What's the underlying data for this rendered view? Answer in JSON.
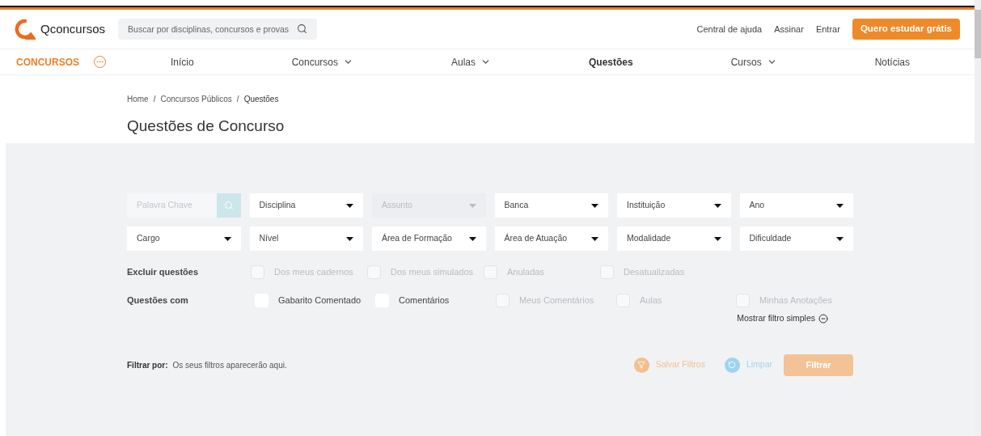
{
  "header": {
    "logo": "Qconcursos",
    "search": {
      "placeholder": "Buscar por disciplinas, concursos e provas"
    },
    "links": [
      "Central de ajuda",
      "Assinar",
      "Entrar"
    ],
    "cta": "Quero estudar grátis"
  },
  "nav": {
    "brand": "CONCURSOS",
    "items": [
      {
        "label": "Início",
        "selected": false,
        "has_menu": false
      },
      {
        "label": "Concursos",
        "selected": false,
        "has_menu": true
      },
      {
        "label": "Aulas",
        "selected": false,
        "has_menu": true
      },
      {
        "label": "Questões",
        "selected": true,
        "has_menu": false
      },
      {
        "label": "Cursos",
        "selected": false,
        "has_menu": true
      },
      {
        "label": "Notícias",
        "selected": false,
        "has_menu": false
      }
    ]
  },
  "breadcrumb": {
    "separator": "/",
    "items": [
      "Home",
      "Concursos Públicos",
      "Questões"
    ]
  },
  "title": "Questões de Concurso",
  "keyword": {
    "placeholder": "Palavra Chave"
  },
  "dropdowns": [
    {
      "label": "Disciplina",
      "disabled": false
    },
    {
      "label": "Assunto",
      "disabled": true
    },
    {
      "label": "Banca",
      "disabled": false
    },
    {
      "label": "Instituição",
      "disabled": false
    },
    {
      "label": "Ano",
      "disabled": false
    },
    {
      "label": "Cargo",
      "disabled": false
    },
    {
      "label": "Nível",
      "disabled": false
    },
    {
      "label": "Área de Formação",
      "disabled": false
    },
    {
      "label": "Área de Atuação",
      "disabled": false
    },
    {
      "label": "Modalidade",
      "disabled": false
    },
    {
      "label": "Dificuldade",
      "disabled": false
    }
  ],
  "exclude": {
    "label": "Excluir questões",
    "options": [
      {
        "label": "Dos meus cadernos",
        "checked": false,
        "disabled": true
      },
      {
        "label": "Dos meus simulados",
        "checked": false,
        "disabled": true
      },
      {
        "label": "Anuladas",
        "checked": false,
        "disabled": true
      },
      {
        "label": "Desatualizadas",
        "checked": false,
        "disabled": true
      }
    ]
  },
  "with": {
    "label": "Questões com",
    "options": [
      {
        "label": "Gabarito Comentado",
        "checked": false,
        "disabled": false
      },
      {
        "label": "Comentários",
        "checked": false,
        "disabled": false
      },
      {
        "label": "Meus Comentários",
        "checked": false,
        "disabled": true
      },
      {
        "label": "Aulas",
        "checked": false,
        "disabled": true
      },
      {
        "label": "Minhas Anotações",
        "checked": false,
        "disabled": true
      }
    ]
  },
  "toggle_filter": "Mostrar filtro simples",
  "filter_by": {
    "label": "Filtrar por:",
    "text": "Os seus filtros aparecerão aqui."
  },
  "actions": {
    "save": {
      "label": "Salvar Filtros",
      "disabled": true
    },
    "clear": {
      "label": "Limpar",
      "disabled": true
    },
    "submit": {
      "label": "Filtrar",
      "disabled": true
    }
  }
}
